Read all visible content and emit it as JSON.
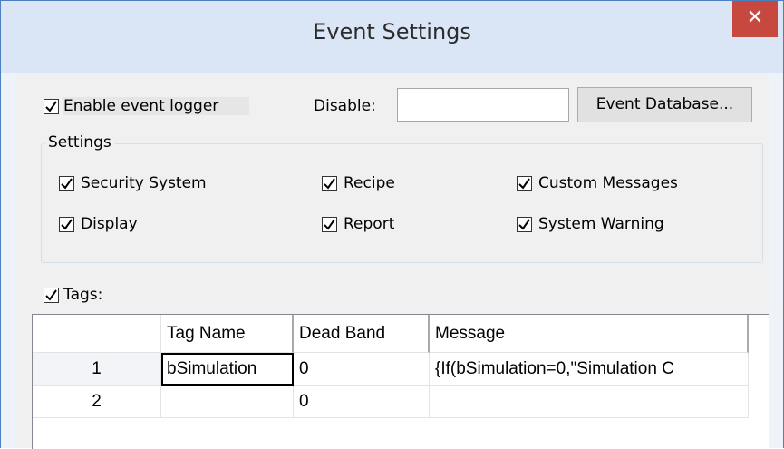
{
  "window": {
    "title": "Event Settings",
    "close_glyph": "✕"
  },
  "logger": {
    "enable_label": "Enable event logger",
    "enable_underline": "E",
    "disable_label": "Disable:",
    "disable_value": "",
    "db_button_label": "Event Database..."
  },
  "settings": {
    "legend": "Settings",
    "options": [
      {
        "label": "Security System",
        "checked": true
      },
      {
        "label": "Recipe",
        "checked": true
      },
      {
        "label": "Custom Messages",
        "checked": true
      },
      {
        "label": "Display",
        "checked": true
      },
      {
        "label": "Report",
        "checked": true
      },
      {
        "label": "System Warning",
        "checked": true
      }
    ]
  },
  "tags": {
    "label": "Tags:",
    "checked": true,
    "columns": [
      "",
      "Tag Name",
      "Dead Band",
      "Message"
    ],
    "rows": [
      {
        "num": "1",
        "tag": "bSimulation",
        "dead_band": "0",
        "message": "{If(bSimulation=0,\"Simulation C"
      },
      {
        "num": "2",
        "tag": "",
        "dead_band": "0",
        "message": ""
      }
    ]
  },
  "icons": {
    "close": "close-icon",
    "check": "check-icon"
  }
}
